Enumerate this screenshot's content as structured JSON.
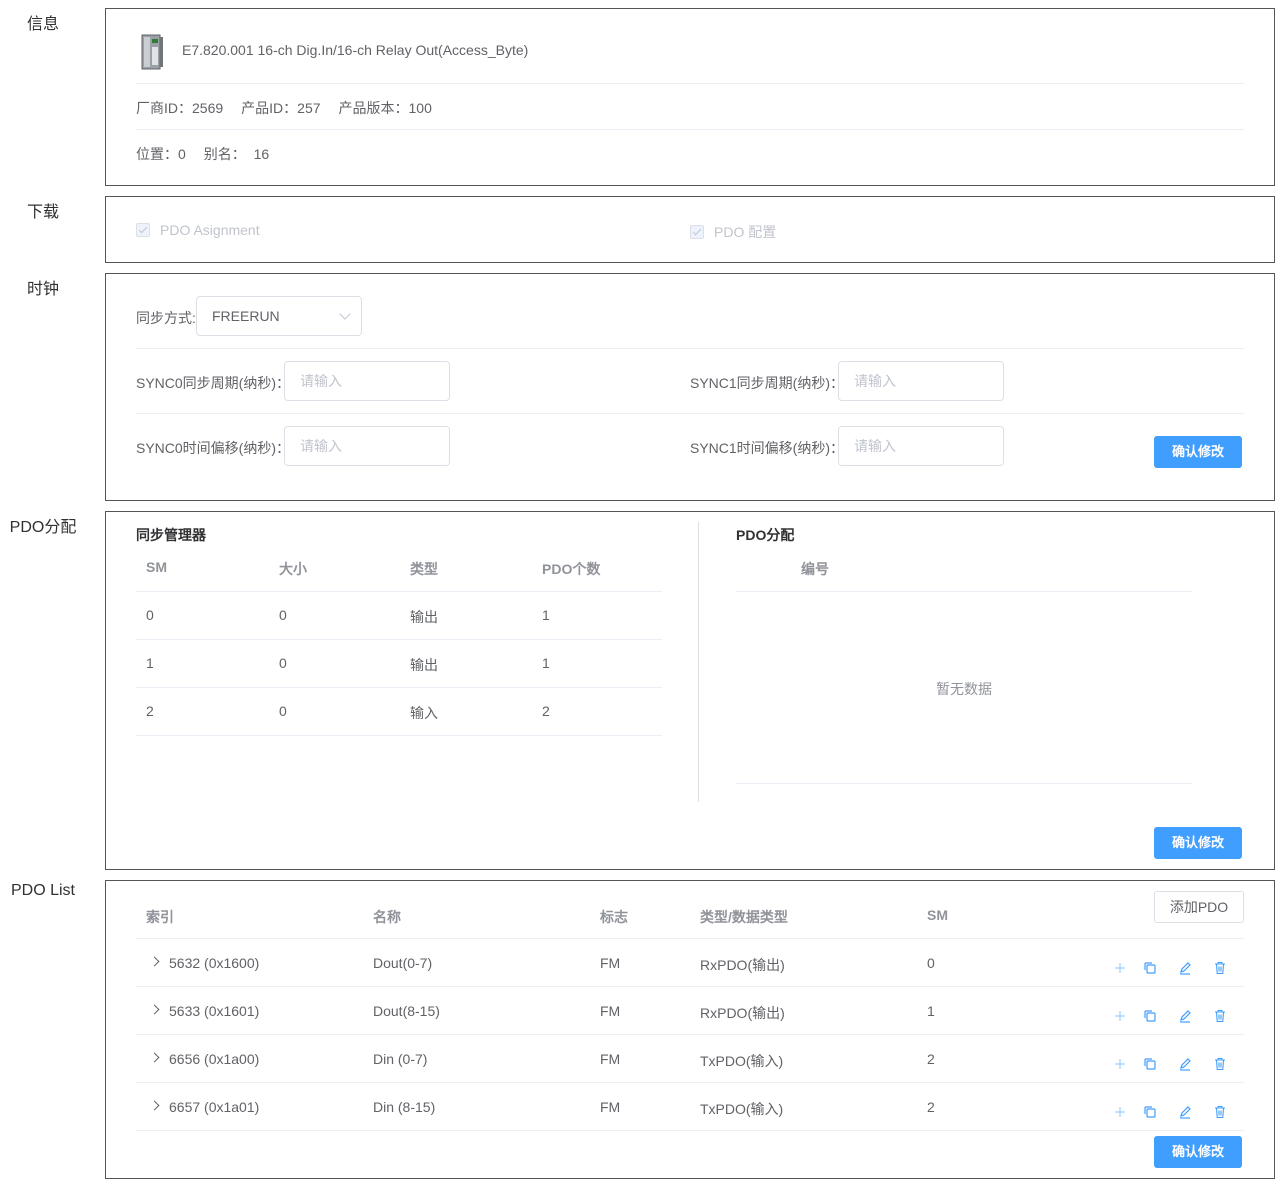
{
  "sections": {
    "info": "信息",
    "download": "下载",
    "clock": "时钟",
    "pdo_assign": "PDO分配",
    "pdo_list": "PDO List"
  },
  "info": {
    "device_name": "E7.820.001 16-ch Dig.In/16-ch Relay Out(Access_Byte)",
    "vendor_id": "厂商ID：2569",
    "product_id": "产品ID：257",
    "product_version": "产品版本：100",
    "position": "位置：0",
    "alias": "别名：  16"
  },
  "download": {
    "pdo_assignment": "PDO Asignment",
    "pdo_config": "PDO 配置"
  },
  "clock": {
    "sync_mode_label": "同步方式:",
    "sync_mode_value": "FREERUN",
    "sync0_cycle_label": "SYNC0同步周期(纳秒)：",
    "sync1_cycle_label": "SYNC1同步周期(纳秒)：",
    "sync0_offset_label": "SYNC0时间偏移(纳秒)：",
    "sync1_offset_label": "SYNC1时间偏移(纳秒)：",
    "placeholder": "请输入",
    "confirm": "确认修改"
  },
  "sm_table": {
    "title": "同步管理器",
    "headers": [
      "SM",
      "大小",
      "类型",
      "PDO个数"
    ],
    "rows": [
      [
        "0",
        "0",
        "输出",
        "1"
      ],
      [
        "1",
        "0",
        "输出",
        "1"
      ],
      [
        "2",
        "0",
        "输入",
        "2"
      ]
    ]
  },
  "pdo_table": {
    "title": "PDO分配",
    "header": "编号",
    "empty": "暂无数据",
    "confirm": "确认修改"
  },
  "pdo_list": {
    "add_button": "添加PDO",
    "headers": [
      "索引",
      "名称",
      "标志",
      "类型/数据类型",
      "SM"
    ],
    "rows": [
      [
        "5632 (0x1600)",
        "Dout(0-7)",
        "FM",
        "RxPDO(输出)",
        "0"
      ],
      [
        "5633 (0x1601)",
        "Dout(8-15)",
        "FM",
        "RxPDO(输出)",
        "1"
      ],
      [
        "6656 (0x1a00)",
        "Din (0-7)",
        "FM",
        "TxPDO(输入)",
        "2"
      ],
      [
        "6657 (0x1a01)",
        "Din (8-15)",
        "FM",
        "TxPDO(输入)",
        "2"
      ]
    ],
    "confirm": "确认修改",
    "row_icons": [
      "plus-icon",
      "copy-icon",
      "edit-icon",
      "delete-icon"
    ]
  },
  "colors": {
    "primary": "#409eff",
    "border": "#555555",
    "divider": "#ebeef5",
    "text": "#606266",
    "header_text": "#909399",
    "disabled": "#c0c4cc"
  }
}
